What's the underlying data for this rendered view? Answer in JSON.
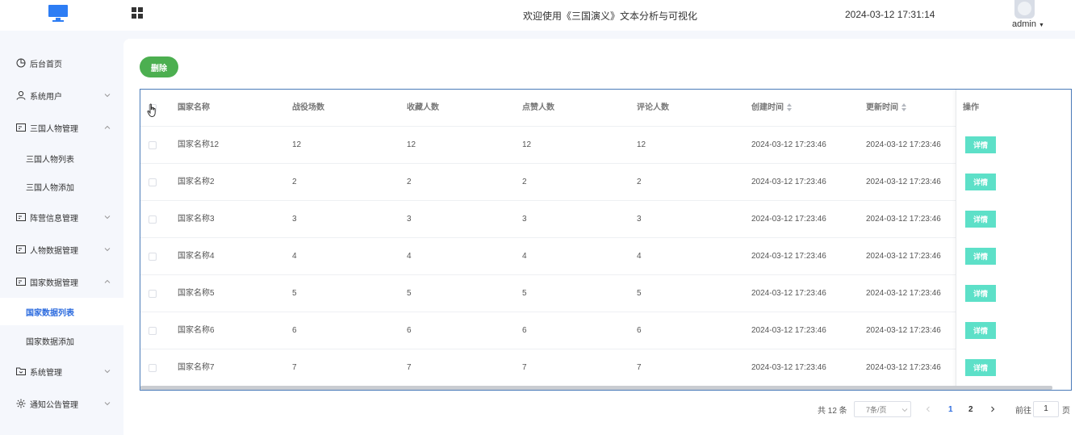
{
  "header": {
    "title": "欢迎使用《三国演义》文本分析与可视化",
    "datetime": "2024-03-12 17:31:14",
    "username": "admin"
  },
  "sidebar": {
    "items": [
      {
        "label": "后台首页",
        "icon": "clock-icon",
        "expandable": false
      },
      {
        "label": "系统用户",
        "icon": "user-icon",
        "expandable": true,
        "expanded": false
      },
      {
        "label": "三国人物管理",
        "icon": "card-icon",
        "expandable": true,
        "expanded": true,
        "children": [
          "三国人物列表",
          "三国人物添加"
        ]
      },
      {
        "label": "阵营信息管理",
        "icon": "card-icon",
        "expandable": true,
        "expanded": false
      },
      {
        "label": "人物数据管理",
        "icon": "card-icon",
        "expandable": true,
        "expanded": false
      },
      {
        "label": "国家数据管理",
        "icon": "card-icon",
        "expandable": true,
        "expanded": true,
        "children": [
          "国家数据列表",
          "国家数据添加"
        ],
        "active_child": "国家数据列表"
      },
      {
        "label": "系统管理",
        "icon": "folder-icon",
        "expandable": true,
        "expanded": false
      },
      {
        "label": "通知公告管理",
        "icon": "sun-icon",
        "expandable": true,
        "expanded": false
      }
    ]
  },
  "toolbar": {
    "delete_label": "删除"
  },
  "table": {
    "columns": [
      "国家名称",
      "战役场数",
      "收藏人数",
      "点赞人数",
      "评论人数",
      "创建时间",
      "更新时间",
      "操作"
    ],
    "rows": [
      [
        "国家名称12",
        "12",
        "12",
        "12",
        "12",
        "2024-03-12 17:23:46",
        "2024-03-12 17:23:46"
      ],
      [
        "国家名称2",
        "2",
        "2",
        "2",
        "2",
        "2024-03-12 17:23:46",
        "2024-03-12 17:23:46"
      ],
      [
        "国家名称3",
        "3",
        "3",
        "3",
        "3",
        "2024-03-12 17:23:46",
        "2024-03-12 17:23:46"
      ],
      [
        "国家名称4",
        "4",
        "4",
        "4",
        "4",
        "2024-03-12 17:23:46",
        "2024-03-12 17:23:46"
      ],
      [
        "国家名称5",
        "5",
        "5",
        "5",
        "5",
        "2024-03-12 17:23:46",
        "2024-03-12 17:23:46"
      ],
      [
        "国家名称6",
        "6",
        "6",
        "6",
        "6",
        "2024-03-12 17:23:46",
        "2024-03-12 17:23:46"
      ],
      [
        "国家名称7",
        "7",
        "7",
        "7",
        "7",
        "2024-03-12 17:23:46",
        "2024-03-12 17:23:46"
      ]
    ],
    "detail_label": "详情"
  },
  "pagination": {
    "total_label": "共 12 条",
    "page_size_label": "7条/页",
    "pages": [
      "1",
      "2"
    ],
    "current_page": "1",
    "goto_label": "前往",
    "goto_value": "1",
    "page_suffix": "页"
  },
  "colors": {
    "accent": "#2d6cdf",
    "delete_button": "#4caf50",
    "detail_button": "#5de0c8",
    "table_border": "#4a7ab8"
  }
}
